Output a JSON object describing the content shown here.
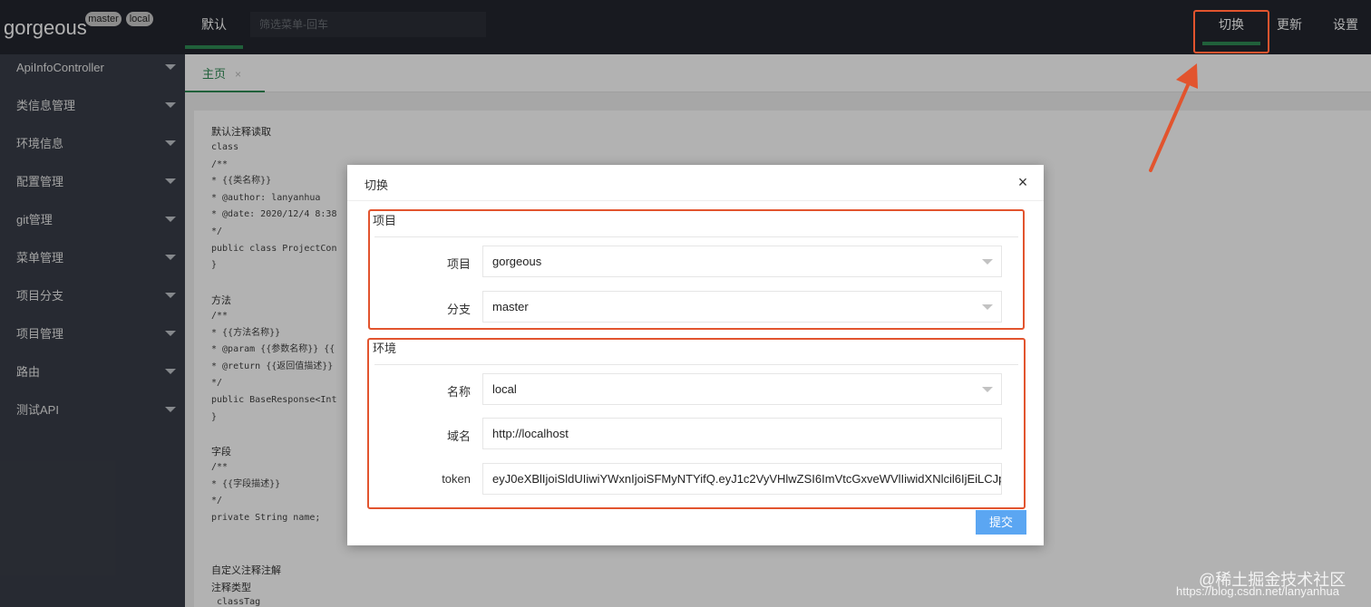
{
  "header": {
    "brand": "gorgeous",
    "branch_badge": "master",
    "env_badge": "local",
    "default_tab": "默认",
    "filter_placeholder": "筛选菜单-回车",
    "actions": {
      "switch": "切换",
      "update": "更新",
      "settings": "设置"
    }
  },
  "sidebar": {
    "items": [
      {
        "label": "ApiInfoController"
      },
      {
        "label": "类信息管理"
      },
      {
        "label": "环境信息"
      },
      {
        "label": "配置管理"
      },
      {
        "label": "git管理"
      },
      {
        "label": "菜单管理"
      },
      {
        "label": "项目分支"
      },
      {
        "label": "项目管理"
      },
      {
        "label": "路由"
      },
      {
        "label": "测试API"
      }
    ]
  },
  "tabs": {
    "home": "主页",
    "close": "×"
  },
  "content": {
    "class_heading": "默认注释读取",
    "class_code": "class\n/**\n* {{类名称}}\n* @author: lanyanhua\n* @date: 2020/12/4 8:38\n*/\npublic class ProjectCon\n}",
    "method_heading": "方法",
    "method_code": "/**\n* {{方法名称}}\n* @param {{参数名称}} {{\n* @return {{返回值描述}}\n*/\npublic BaseResponse<Int\n}",
    "field_heading": "字段",
    "field_code": "/**\n* {{字段描述}}\n*/\nprivate String name;",
    "custom_heading": "自定义注释注解",
    "type_heading": "注释类型",
    "type_code": " classTag"
  },
  "modal": {
    "title": "切换",
    "close_icon": "×",
    "project_section": "项目",
    "project_label": "项目",
    "project_value": "gorgeous",
    "branch_label": "分支",
    "branch_value": "master",
    "env_section": "环境",
    "name_label": "名称",
    "name_value": "local",
    "domain_label": "域名",
    "domain_value": "http://localhost",
    "token_label": "token",
    "token_value": "eyJ0eXBlIjoiSldUIiwiYWxnIjoiSFMyNTYifQ.eyJ1c2VyVHlwZSI6ImVtcGxveWVlIiwidXNlcil6IjEiLCJp",
    "submit": "提交"
  },
  "watermark": {
    "line1": "@稀土掘金技术社区",
    "line2": "https://blog.csdn.net/lanyanhua"
  },
  "colors": {
    "accent": "#2f8a54",
    "annotation": "#e2542e",
    "submit": "#5ba6f2",
    "header": "#23262e",
    "sidebar": "#393d48"
  }
}
